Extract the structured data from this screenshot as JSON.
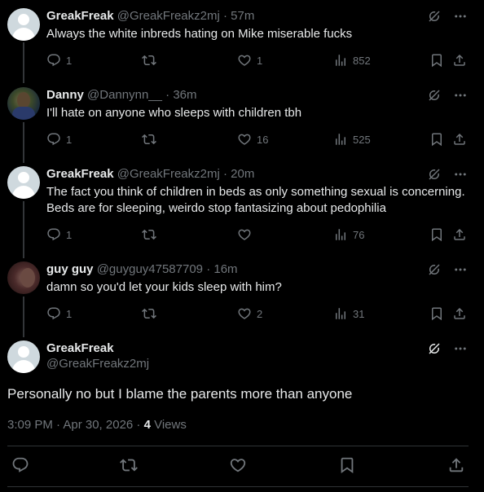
{
  "tweets": [
    {
      "name": "GreakFreak",
      "handle": "@GreakFreakz2mj",
      "time": "· 57m",
      "text": "Always the white inbreds hating on Mike miserable fucks",
      "replies": "1",
      "retweets": "",
      "likes": "1",
      "views": "852"
    },
    {
      "name": "Danny",
      "handle": "@Dannynn__",
      "time": "· 36m",
      "text": "I'll hate on anyone who sleeps with children tbh",
      "replies": "1",
      "retweets": "",
      "likes": "16",
      "views": "525"
    },
    {
      "name": "GreakFreak",
      "handle": "@GreakFreakz2mj",
      "time": "· 20m",
      "text": "The fact you think of children in beds as only something sexual is concerning. Beds are for sleeping, weirdo stop fantasizing about pedophilia",
      "replies": "1",
      "retweets": "",
      "likes": "",
      "views": "76"
    },
    {
      "name": "guy guy",
      "handle": "@guyguy47587709",
      "time": "· 16m",
      "text": "damn so you'd let your kids sleep with him?",
      "replies": "1",
      "retweets": "",
      "likes": "2",
      "views": "31"
    }
  ],
  "main": {
    "name": "GreakFreak",
    "handle": "@GreakFreakz2mj",
    "text": "Personally no but I blame the parents more than anyone",
    "timestamp": "3:09 PM · Apr 30, 2026 · ",
    "views_count": "4",
    "views_label": " Views"
  },
  "icons": [
    "grok-icon",
    "more-icon",
    "reply-icon",
    "retweet-icon",
    "like-icon",
    "views-icon",
    "bookmark-icon",
    "share-icon"
  ],
  "colors": {
    "background": "#000000",
    "text": "#e7e9ea",
    "muted": "#71767b",
    "divider": "#2f3336"
  }
}
